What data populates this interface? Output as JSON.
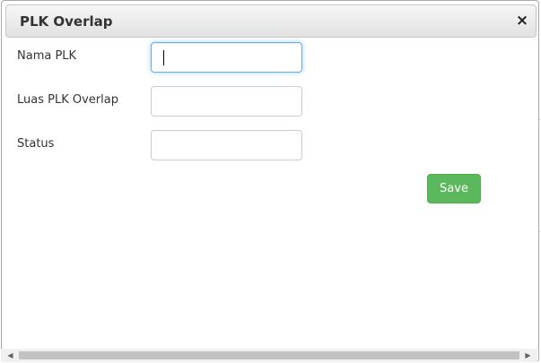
{
  "dialog": {
    "title": "PLK Overlap",
    "close_icon": "close-icon",
    "close_glyph": "×"
  },
  "form": {
    "fields": [
      {
        "label": "Nama PLK",
        "value": "",
        "focused": true
      },
      {
        "label": "Luas PLK Overlap",
        "value": ""
      },
      {
        "label": "Status",
        "value": ""
      }
    ],
    "save_label": "Save"
  },
  "scrollbar": {
    "left_arrow": "◀",
    "right_arrow": "▶"
  },
  "colors": {
    "save_button": "#5cb85c",
    "focus_border": "#66afe9",
    "header_bg": "#e9e9e9"
  }
}
